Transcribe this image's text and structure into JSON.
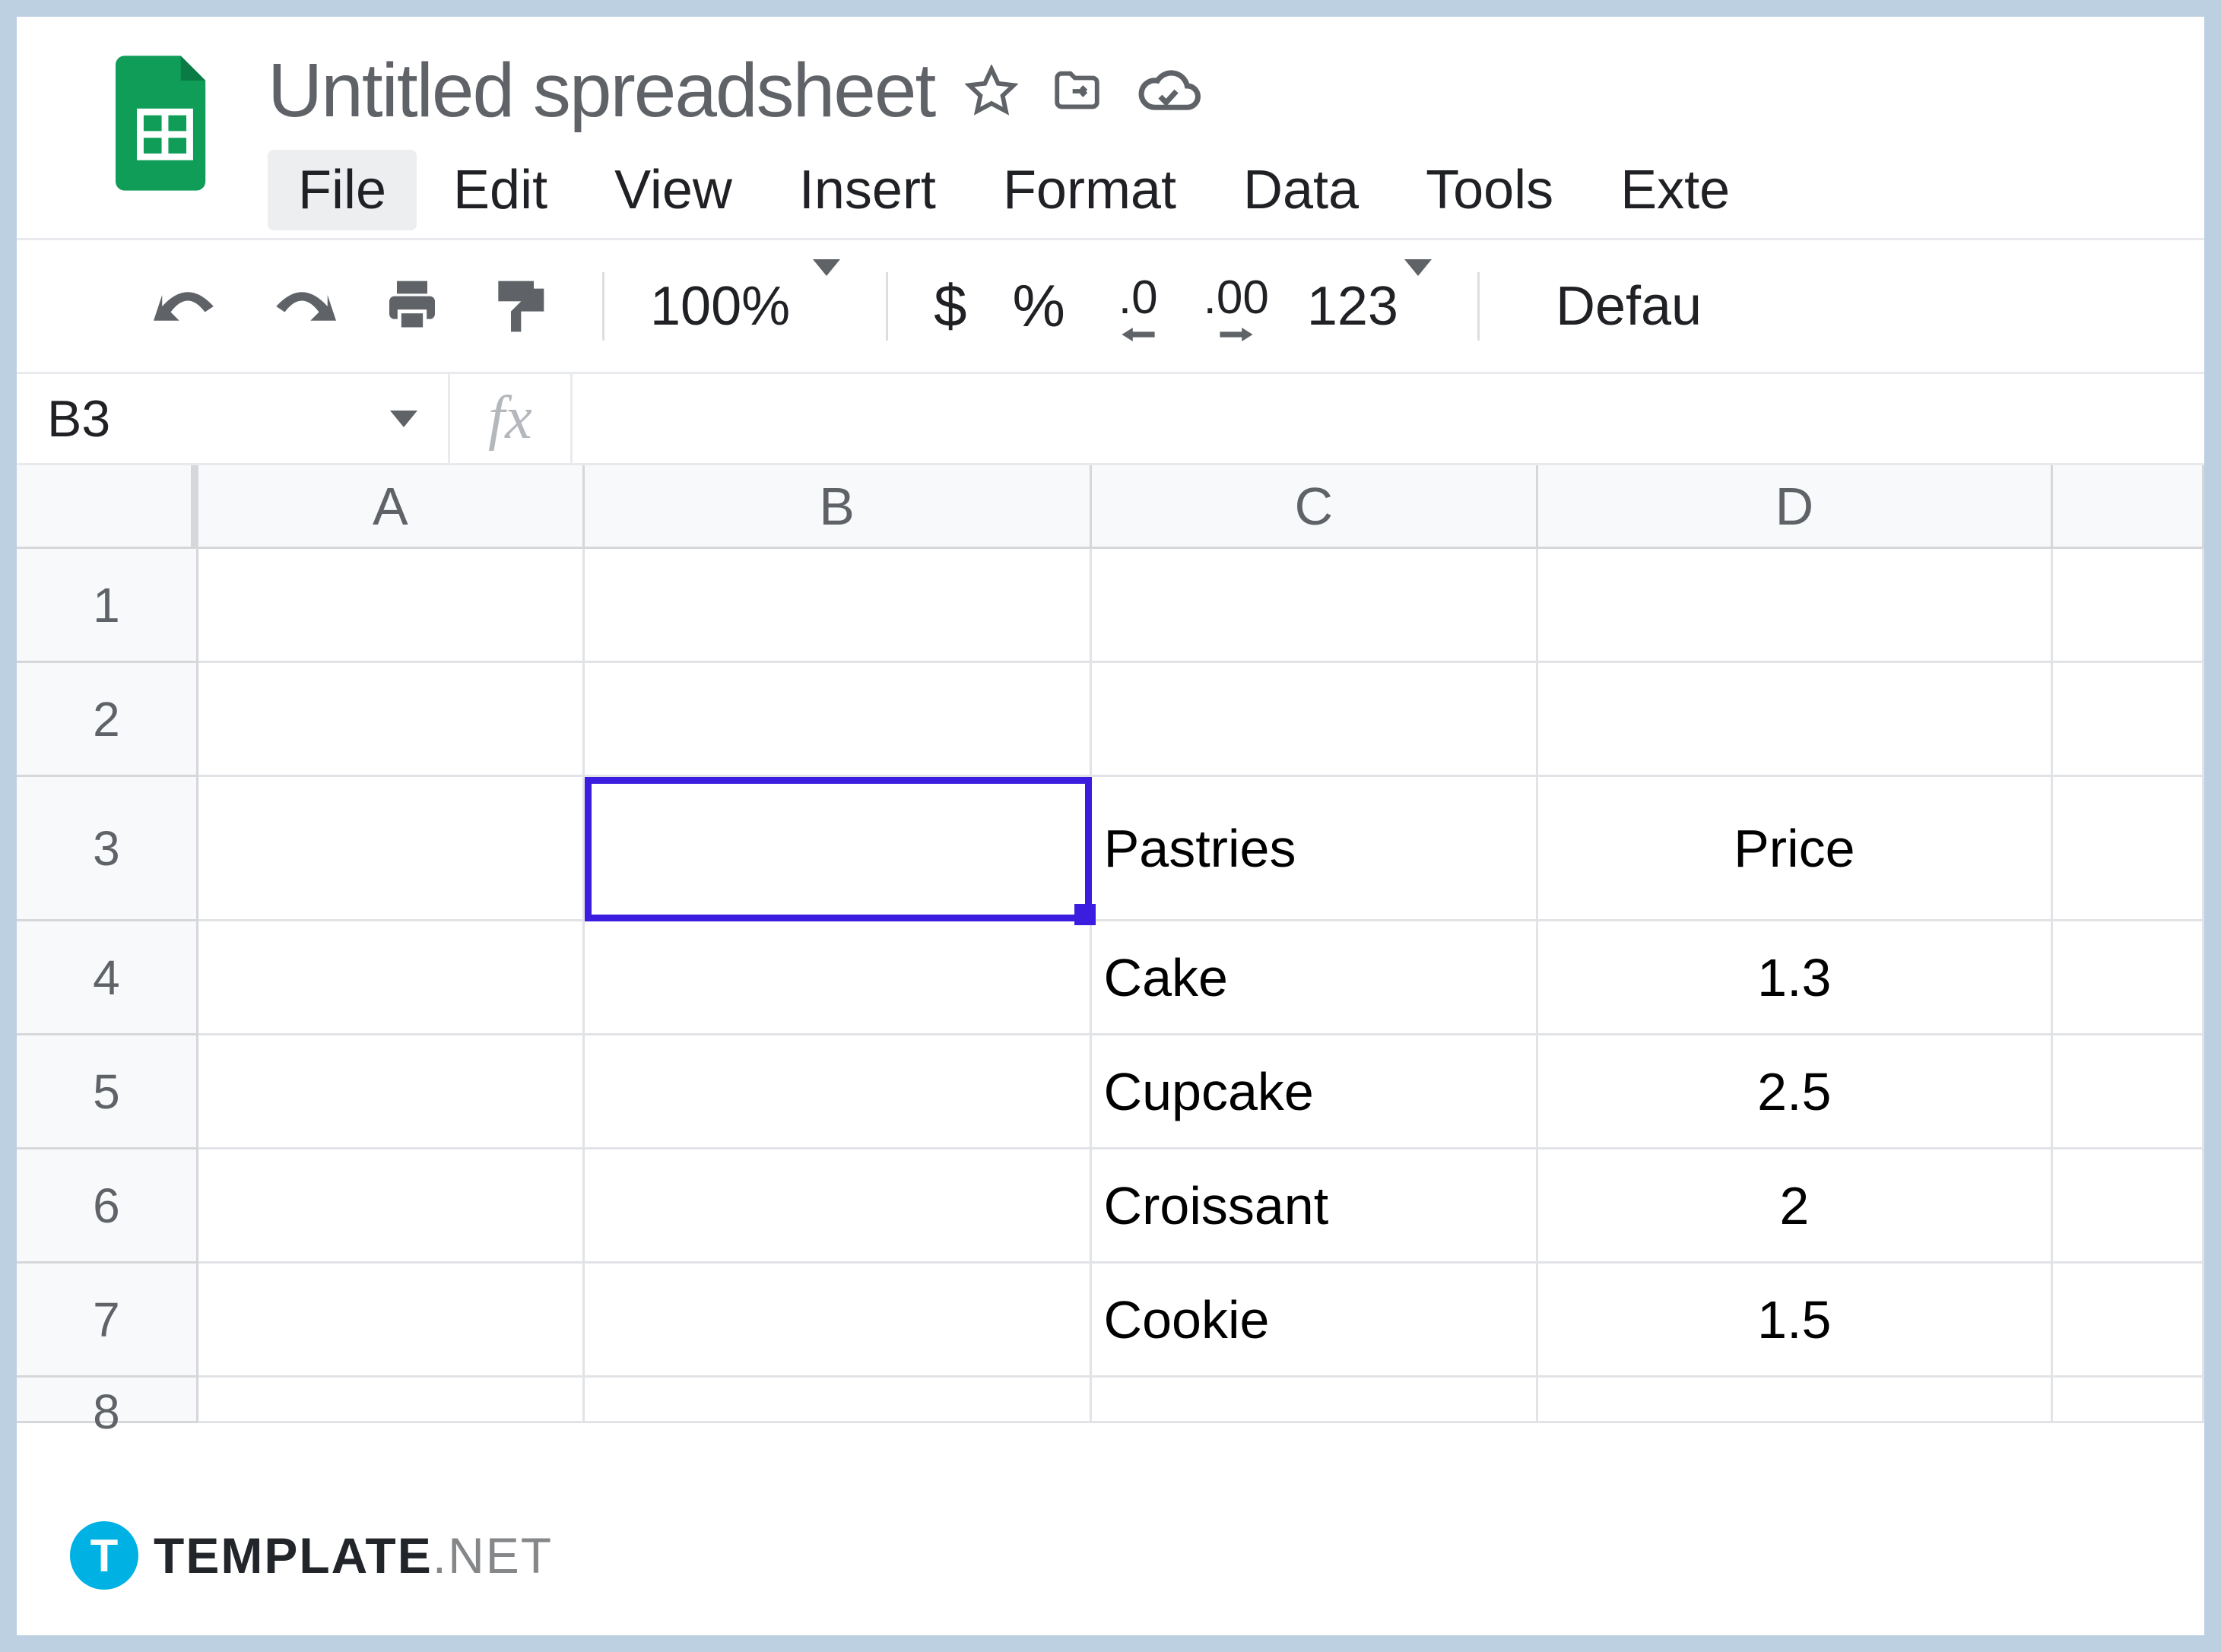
{
  "doc": {
    "title": "Untitled spreadsheet"
  },
  "menu": {
    "file": "File",
    "edit": "Edit",
    "view": "View",
    "insert": "Insert",
    "format": "Format",
    "data": "Data",
    "tools": "Tools",
    "extensions": "Exte"
  },
  "toolbar": {
    "zoom": "100%",
    "currency": "$",
    "percent": "%",
    "dec_dec": ".0",
    "inc_dec": ".00",
    "num_fmt": "123",
    "font": "Defau"
  },
  "namebox": {
    "ref": "B3"
  },
  "fx": {
    "label": "fx"
  },
  "columns": [
    "A",
    "B",
    "C",
    "D"
  ],
  "rows": [
    "1",
    "2",
    "3",
    "4",
    "5",
    "6",
    "7",
    "8"
  ],
  "cells": {
    "C3": "Pastries",
    "D3": "Price",
    "C4": "Cake",
    "D4": "1.3",
    "C5": "Cupcake",
    "D5": "2.5",
    "C6": "Croissant",
    "D6": "2",
    "C7": "Cookie",
    "D7": "1.5"
  },
  "watermark": {
    "bold": "TEMPLATE",
    "light": ".NET"
  }
}
